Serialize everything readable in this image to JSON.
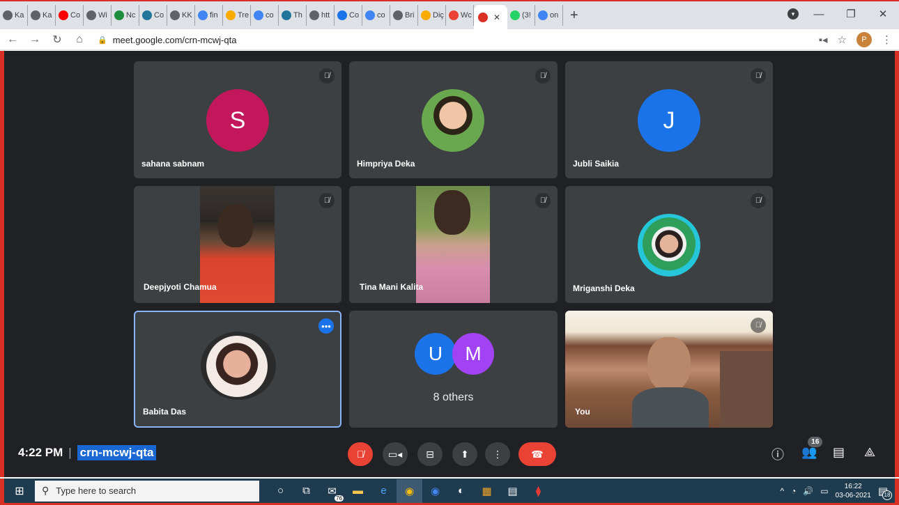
{
  "browser": {
    "tabs": [
      {
        "label": "Ka",
        "fav": "globe-icon",
        "color": "#5f6368"
      },
      {
        "label": "Ka",
        "fav": "globe-icon",
        "color": "#5f6368"
      },
      {
        "label": "Co",
        "fav": "youtube-icon",
        "color": "#ff0000"
      },
      {
        "label": "Wi",
        "fav": "globe-icon",
        "color": "#5f6368"
      },
      {
        "label": "Nc",
        "fav": "chat-icon",
        "color": "#1e8e3e"
      },
      {
        "label": "Co",
        "fav": "wordpress-icon",
        "color": "#21759b"
      },
      {
        "label": "KK",
        "fav": "globe-icon",
        "color": "#5f6368"
      },
      {
        "label": "fin",
        "fav": "google-icon",
        "color": "#4285f4"
      },
      {
        "label": "Tre",
        "fav": "bookmark-icon",
        "color": "#f9ab00"
      },
      {
        "label": "co",
        "fav": "google-icon",
        "color": "#4285f4"
      },
      {
        "label": "Th",
        "fav": "wordpress-icon",
        "color": "#21759b"
      },
      {
        "label": "htt",
        "fav": "doc-icon",
        "color": "#5f6368"
      },
      {
        "label": "Co",
        "fav": "target-icon",
        "color": "#1a73e8"
      },
      {
        "label": "co",
        "fav": "google-icon",
        "color": "#4285f4"
      },
      {
        "label": "Bri",
        "fav": "globe-icon",
        "color": "#5f6368"
      },
      {
        "label": "Diç",
        "fav": "docs-icon",
        "color": "#f9ab00"
      },
      {
        "label": "Wc",
        "fav": "gmail-icon",
        "color": "#ea4335"
      },
      {
        "label": "",
        "fav": "meet-recording-icon",
        "color": "#d93025",
        "active": true
      },
      {
        "label": "(3!",
        "fav": "whatsapp-icon",
        "color": "#25d366"
      },
      {
        "label": "on",
        "fav": "google-icon",
        "color": "#4285f4"
      }
    ],
    "url": "meet.google.com/crn-mcwj-qta",
    "profile_letter": "P"
  },
  "meet": {
    "participants": [
      {
        "name": "sahana sabnam",
        "avatar_letter": "S",
        "avatar_color": "#c2185b",
        "muted": true
      },
      {
        "name": "Himpriya Deka",
        "avatar_letter": "",
        "avatar_color": "#7cb342",
        "muted": true
      },
      {
        "name": "Jubli Saikia",
        "avatar_letter": "J",
        "avatar_color": "#1a73e8",
        "muted": true
      },
      {
        "name": "Deepjyoti Chamua",
        "muted": true
      },
      {
        "name": "Tina Mani Kalita",
        "muted": true
      },
      {
        "name": "Mriganshi Deka",
        "avatar_color": "#26c6da",
        "muted": true
      },
      {
        "name": "Babita Das",
        "muted": false
      },
      {
        "name": "You",
        "muted": true
      }
    ],
    "others": {
      "avatars": [
        {
          "letter": "U",
          "color": "#1a73e8"
        },
        {
          "letter": "M",
          "color": "#a142f4"
        }
      ],
      "label": "8 others"
    },
    "time": "4:22 PM",
    "meeting_code": "crn-mcwj-qta",
    "people_count": "16"
  },
  "taskbar": {
    "search_placeholder": "Type here to search",
    "mail_badge": "76",
    "time": "16:22",
    "date": "03-06-2021",
    "notifications": "18"
  }
}
